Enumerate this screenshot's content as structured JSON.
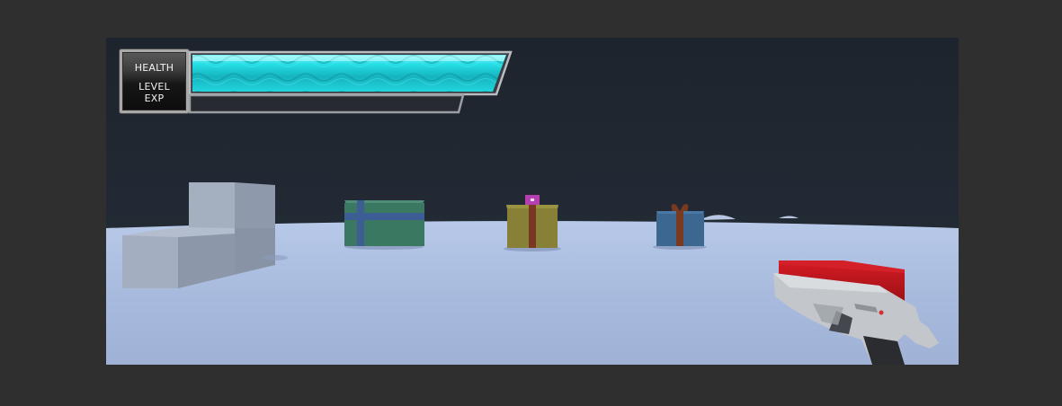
{
  "hud": {
    "labels": {
      "health": "HEALTH",
      "level": "LEVEL",
      "exp": "EXP"
    },
    "health_fill": 1.0,
    "exp_fill": 0.0
  },
  "scene": {
    "objects": [
      {
        "type": "block-structure",
        "icon": "l-shaped-block",
        "color": "#9aa6b8"
      },
      {
        "type": "gift-box",
        "icon": "gift-green",
        "color": "#3d7a64",
        "ribbon": "#3d5e8f"
      },
      {
        "type": "gift-box",
        "icon": "gift-olive",
        "color": "#8a8438",
        "ribbon": "#7a3a22",
        "tag": "#b53fb0"
      },
      {
        "type": "gift-box",
        "icon": "gift-blue",
        "color": "#3f6a94",
        "ribbon": "#7a3a22"
      },
      {
        "type": "weapon",
        "icon": "pistol",
        "color": "#c5c8cc"
      },
      {
        "type": "pickup",
        "icon": "red-crate",
        "color": "#b8141c"
      }
    ],
    "colors": {
      "sky": "#1f2630",
      "ground": "#a9bcdf",
      "frame": "#2f2f2f",
      "health_bar": "#1fd3dc"
    }
  }
}
